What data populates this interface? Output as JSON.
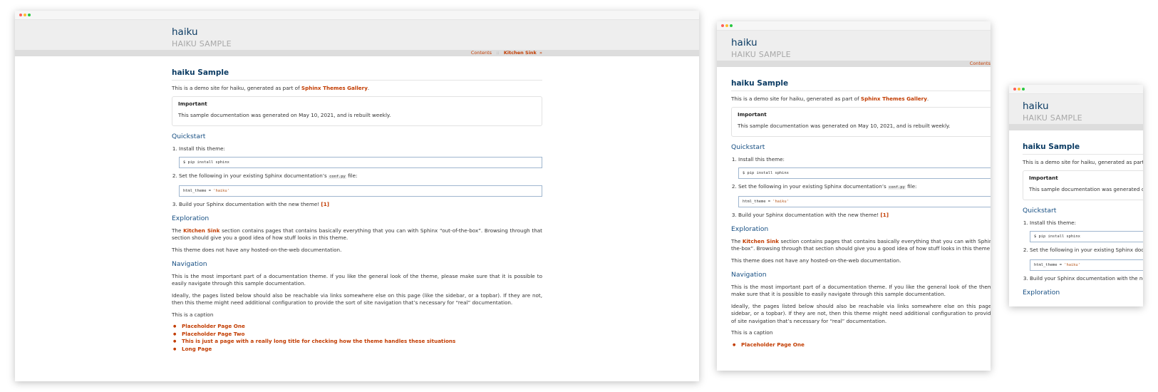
{
  "site": {
    "title": "haiku",
    "subtitle": "HAIKU SAMPLE"
  },
  "nav": {
    "contents": "Contents",
    "separator": "::",
    "current": "Kitchen Sink",
    "arrow": "»"
  },
  "page": {
    "heading": "haiku Sample",
    "intro_prefix": "This is a demo site for haiku, generated as part of ",
    "intro_link": "Sphinx Themes Gallery",
    "intro_suffix": ".",
    "admonition_title": "Important",
    "admonition_body": "This sample documentation was generated on May 10, 2021, and is rebuilt weekly.",
    "quickstart_heading": "Quickstart",
    "step1": "Install this theme:",
    "step1_code": "$ pip install sphinx",
    "step2_prefix": "Set the following in your existing Sphinx documentation’s ",
    "step2_code": "conf.py",
    "step2_suffix": " file:",
    "step2_code_block_key": "html_theme = ",
    "step2_code_block_val": "'haiku'",
    "step3": "Build your Sphinx documentation with the new theme! ",
    "step3_ref": "[1]",
    "exploration_heading": "Exploration",
    "exploration_prefix": "The ",
    "exploration_link": "Kitchen Sink",
    "exploration_suffix": " section contains pages that contains basically everything that you can with Sphinx “out-of-the-box”. Browsing through that section should give you a good idea of how stuff looks in this theme.",
    "exploration_note": "This theme does not have any hosted-on-the-web documentation.",
    "navigation_heading": "Navigation",
    "navigation_p1": "This is the most important part of a documentation theme. If you like the general look of the theme, please make sure that it is possible to easily navigate through this sample documentation.",
    "navigation_p2": "Ideally, the pages listed below should also be reachable via links somewhere else on this page (like the sidebar, or a topbar). If they are not, then this theme might need additional configuration to provide the sort of site navigation that’s necessary for “real” documentation.",
    "caption": "This is a caption",
    "toc": [
      "Placeholder Page One",
      "Placeholder Page Two",
      "This is just a page with a really long title for checking how the theme handles these situations",
      "Long Page"
    ]
  },
  "colors": {
    "link": "#c23c00",
    "heading": "#0b3b63",
    "header_bg": "#eeeeee",
    "nav_bg": "#dddddd"
  }
}
